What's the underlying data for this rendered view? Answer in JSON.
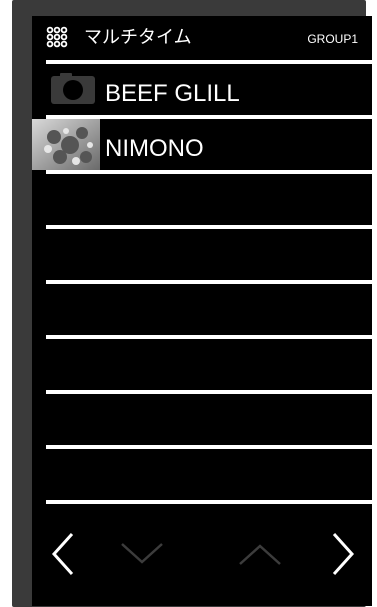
{
  "header": {
    "title": "マルチタイム",
    "group": "GROUP1",
    "icon": "grid-menu-icon"
  },
  "items": [
    {
      "label": "BEEF GLILL",
      "icon": "camera-icon"
    },
    {
      "label": "NIMONO",
      "icon": "food-photo"
    },
    {
      "label": ""
    },
    {
      "label": ""
    },
    {
      "label": ""
    },
    {
      "label": ""
    },
    {
      "label": ""
    },
    {
      "label": ""
    }
  ],
  "nav": {
    "prev": "chevron-left-icon",
    "down": "chevron-down-icon",
    "up": "chevron-up-icon",
    "next": "chevron-right-icon"
  },
  "colors": {
    "background": "#000000",
    "frame": "#3a3a3a",
    "separator": "#ffffff",
    "disabled_arrow": "#3c3c3c"
  }
}
